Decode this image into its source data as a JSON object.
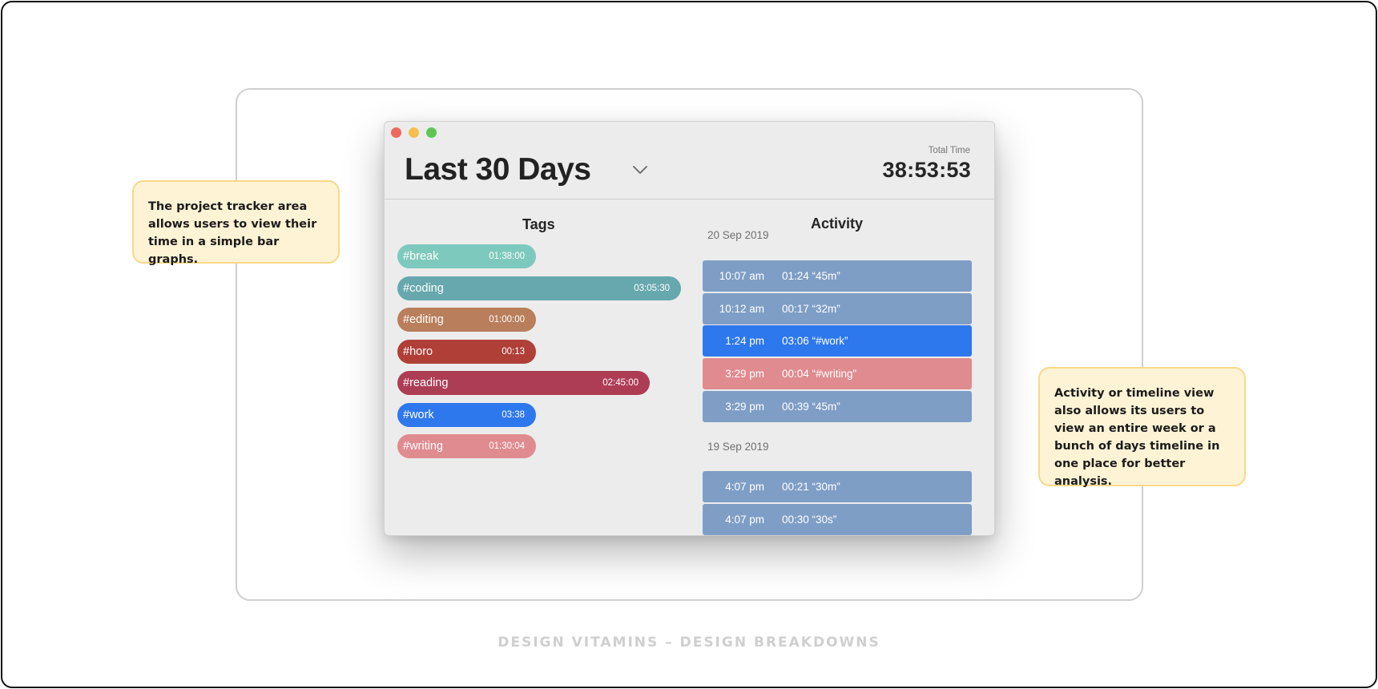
{
  "window": {
    "traffic_lights": [
      "close",
      "minimize",
      "maximize"
    ],
    "range_title": "Last 30 Days",
    "range_dropdown_icon": "chevron-down-icon",
    "total_time_label": "Total Time",
    "total_time_value": "38:53:53"
  },
  "tags": {
    "title": "Tags",
    "items": [
      {
        "name": "#break",
        "time": "01:38:00",
        "color": "#7ec9bd",
        "relative_length": 0.49
      },
      {
        "name": "#coding",
        "time": "03:05:30",
        "color": "#67a8ae",
        "relative_length": 1.0
      },
      {
        "name": "#editing",
        "time": "01:00:00",
        "color": "#b97e5b",
        "relative_length": 0.49
      },
      {
        "name": "#horo",
        "time": "00:13",
        "color": "#b03f37",
        "relative_length": 0.49
      },
      {
        "name": "#reading",
        "time": "02:45:00",
        "color": "#ad3d55",
        "relative_length": 0.89
      },
      {
        "name": "#work",
        "time": "03:38",
        "color": "#2e78ee",
        "relative_length": 0.49
      },
      {
        "name": "#writing",
        "time": "01:30:04",
        "color": "#e08b8f",
        "relative_length": 0.49
      }
    ]
  },
  "activity": {
    "title": "Activity",
    "groups": [
      {
        "date": "20 Sep 2019",
        "entries": [
          {
            "start": "10:07 am",
            "detail": "01:24 “45m”",
            "color": "#7f9ec6"
          },
          {
            "start": "10:12 am",
            "detail": "00:17 “32m”",
            "color": "#7f9ec6"
          },
          {
            "start": "1:24 pm",
            "detail": "03:06 “#work”",
            "color": "#2e78ee"
          },
          {
            "start": "3:29 pm",
            "detail": "00:04 “#writing”",
            "color": "#e08b8f"
          },
          {
            "start": "3:29 pm",
            "detail": "00:39 “45m”",
            "color": "#7f9ec6"
          }
        ]
      },
      {
        "date": "19 Sep 2019",
        "entries": [
          {
            "start": "4:07 pm",
            "detail": "00:21 “30m”",
            "color": "#7f9ec6"
          },
          {
            "start": "4:07 pm",
            "detail": "00:30 “30s”",
            "color": "#7f9ec6"
          }
        ]
      }
    ]
  },
  "callouts": {
    "left": "The project tracker area allows users to view their time in a simple bar graphs.",
    "right": "Activity or timeline view also allows its users to view an entire week or a bunch of days timeline in one place for better analysis."
  },
  "footer": "DESIGN VITAMINS – DESIGN BREAKDOWNS"
}
